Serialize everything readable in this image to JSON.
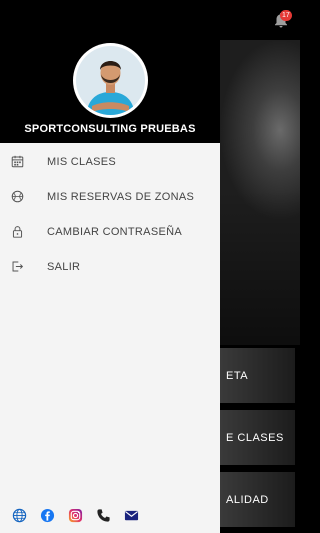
{
  "background": {
    "tiles": [
      "ETA",
      "E CLASES",
      "ALIDAD"
    ],
    "notification_count": "17"
  },
  "drawer": {
    "user_name": "SPORTCONSULTING PRUEBAS",
    "menu": [
      {
        "label": "MIS CLASES",
        "icon": "calendar-icon"
      },
      {
        "label": "MIS RESERVAS DE ZONAS",
        "icon": "basketball-icon"
      },
      {
        "label": "CAMBIAR CONTRASEÑA",
        "icon": "lock-icon"
      },
      {
        "label": "SALIR",
        "icon": "logout-icon"
      }
    ],
    "social": [
      "globe-icon",
      "facebook-icon",
      "instagram-icon",
      "phone-icon",
      "mail-icon"
    ]
  },
  "colors": {
    "drawer_background": "#f4f4f4",
    "header_background": "#000000",
    "badge": "#e53935",
    "facebook": "#1877f2",
    "link_blue": "#1565c0"
  }
}
